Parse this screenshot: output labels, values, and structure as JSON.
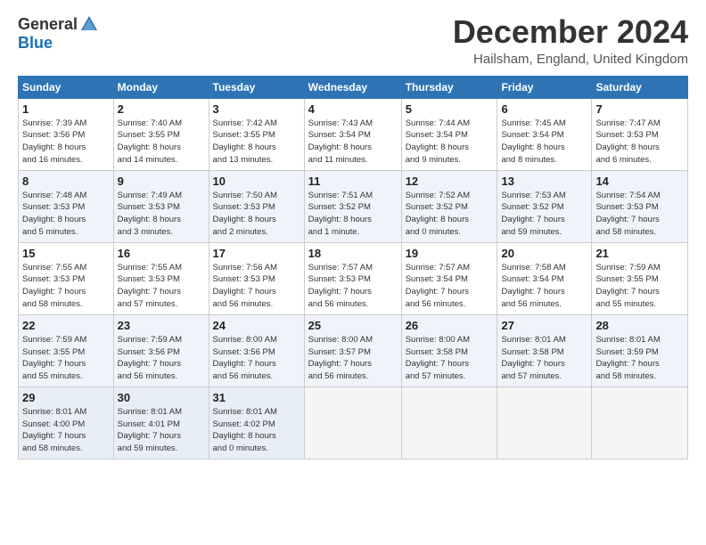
{
  "logo": {
    "general": "General",
    "blue": "Blue"
  },
  "title": {
    "month": "December 2024",
    "location": "Hailsham, England, United Kingdom"
  },
  "weekdays": [
    "Sunday",
    "Monday",
    "Tuesday",
    "Wednesday",
    "Thursday",
    "Friday",
    "Saturday"
  ],
  "weeks": [
    [
      {
        "day": "1",
        "info": "Sunrise: 7:39 AM\nSunset: 3:56 PM\nDaylight: 8 hours\nand 16 minutes."
      },
      {
        "day": "2",
        "info": "Sunrise: 7:40 AM\nSunset: 3:55 PM\nDaylight: 8 hours\nand 14 minutes."
      },
      {
        "day": "3",
        "info": "Sunrise: 7:42 AM\nSunset: 3:55 PM\nDaylight: 8 hours\nand 13 minutes."
      },
      {
        "day": "4",
        "info": "Sunrise: 7:43 AM\nSunset: 3:54 PM\nDaylight: 8 hours\nand 11 minutes."
      },
      {
        "day": "5",
        "info": "Sunrise: 7:44 AM\nSunset: 3:54 PM\nDaylight: 8 hours\nand 9 minutes."
      },
      {
        "day": "6",
        "info": "Sunrise: 7:45 AM\nSunset: 3:54 PM\nDaylight: 8 hours\nand 8 minutes."
      },
      {
        "day": "7",
        "info": "Sunrise: 7:47 AM\nSunset: 3:53 PM\nDaylight: 8 hours\nand 6 minutes."
      }
    ],
    [
      {
        "day": "8",
        "info": "Sunrise: 7:48 AM\nSunset: 3:53 PM\nDaylight: 8 hours\nand 5 minutes."
      },
      {
        "day": "9",
        "info": "Sunrise: 7:49 AM\nSunset: 3:53 PM\nDaylight: 8 hours\nand 3 minutes."
      },
      {
        "day": "10",
        "info": "Sunrise: 7:50 AM\nSunset: 3:53 PM\nDaylight: 8 hours\nand 2 minutes."
      },
      {
        "day": "11",
        "info": "Sunrise: 7:51 AM\nSunset: 3:52 PM\nDaylight: 8 hours\nand 1 minute."
      },
      {
        "day": "12",
        "info": "Sunrise: 7:52 AM\nSunset: 3:52 PM\nDaylight: 8 hours\nand 0 minutes."
      },
      {
        "day": "13",
        "info": "Sunrise: 7:53 AM\nSunset: 3:52 PM\nDaylight: 7 hours\nand 59 minutes."
      },
      {
        "day": "14",
        "info": "Sunrise: 7:54 AM\nSunset: 3:53 PM\nDaylight: 7 hours\nand 58 minutes."
      }
    ],
    [
      {
        "day": "15",
        "info": "Sunrise: 7:55 AM\nSunset: 3:53 PM\nDaylight: 7 hours\nand 58 minutes."
      },
      {
        "day": "16",
        "info": "Sunrise: 7:55 AM\nSunset: 3:53 PM\nDaylight: 7 hours\nand 57 minutes."
      },
      {
        "day": "17",
        "info": "Sunrise: 7:56 AM\nSunset: 3:53 PM\nDaylight: 7 hours\nand 56 minutes."
      },
      {
        "day": "18",
        "info": "Sunrise: 7:57 AM\nSunset: 3:53 PM\nDaylight: 7 hours\nand 56 minutes."
      },
      {
        "day": "19",
        "info": "Sunrise: 7:57 AM\nSunset: 3:54 PM\nDaylight: 7 hours\nand 56 minutes."
      },
      {
        "day": "20",
        "info": "Sunrise: 7:58 AM\nSunset: 3:54 PM\nDaylight: 7 hours\nand 56 minutes."
      },
      {
        "day": "21",
        "info": "Sunrise: 7:59 AM\nSunset: 3:55 PM\nDaylight: 7 hours\nand 55 minutes."
      }
    ],
    [
      {
        "day": "22",
        "info": "Sunrise: 7:59 AM\nSunset: 3:55 PM\nDaylight: 7 hours\nand 55 minutes."
      },
      {
        "day": "23",
        "info": "Sunrise: 7:59 AM\nSunset: 3:56 PM\nDaylight: 7 hours\nand 56 minutes."
      },
      {
        "day": "24",
        "info": "Sunrise: 8:00 AM\nSunset: 3:56 PM\nDaylight: 7 hours\nand 56 minutes."
      },
      {
        "day": "25",
        "info": "Sunrise: 8:00 AM\nSunset: 3:57 PM\nDaylight: 7 hours\nand 56 minutes."
      },
      {
        "day": "26",
        "info": "Sunrise: 8:00 AM\nSunset: 3:58 PM\nDaylight: 7 hours\nand 57 minutes."
      },
      {
        "day": "27",
        "info": "Sunrise: 8:01 AM\nSunset: 3:58 PM\nDaylight: 7 hours\nand 57 minutes."
      },
      {
        "day": "28",
        "info": "Sunrise: 8:01 AM\nSunset: 3:59 PM\nDaylight: 7 hours\nand 58 minutes."
      }
    ],
    [
      {
        "day": "29",
        "info": "Sunrise: 8:01 AM\nSunset: 4:00 PM\nDaylight: 7 hours\nand 58 minutes."
      },
      {
        "day": "30",
        "info": "Sunrise: 8:01 AM\nSunset: 4:01 PM\nDaylight: 7 hours\nand 59 minutes."
      },
      {
        "day": "31",
        "info": "Sunrise: 8:01 AM\nSunset: 4:02 PM\nDaylight: 8 hours\nand 0 minutes."
      },
      null,
      null,
      null,
      null
    ]
  ]
}
